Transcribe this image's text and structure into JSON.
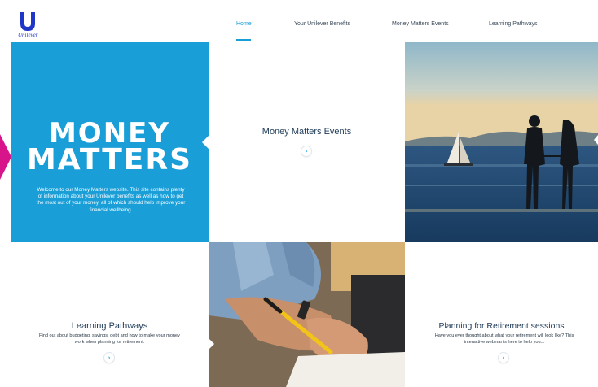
{
  "brand": {
    "logo_text": "Unilever"
  },
  "nav": {
    "items": [
      {
        "label": "Home",
        "active": true
      },
      {
        "label": "Your Unilever Benefits",
        "active": false
      },
      {
        "label": "Money Matters Events",
        "active": false
      },
      {
        "label": "Learning Pathways",
        "active": false
      }
    ]
  },
  "hero": {
    "title_line1": "MONEY",
    "title_line2": "MATTERS",
    "intro": "Welcome to our Money Matters website. This site contains plenty of information about your Unilever benefits as well as how to get the most out of your money, all of which should help improve your financial wellbeing."
  },
  "tiles": {
    "events": {
      "heading": "Money Matters Events"
    },
    "learning": {
      "heading": "Learning Pathways",
      "body": "Find out about budgeting, savings, debt and how to make your money work when planning for retirement."
    },
    "retirement": {
      "heading": "Planning for Retirement sessions",
      "body": "Have you ever thought about what your retirement will look like? This interactive webinar is here to help you..."
    }
  },
  "icons": {
    "arrow": "chevron-right-icon",
    "logo": "unilever-u-logo"
  },
  "colors": {
    "brand_blue": "#1a9ed8",
    "accent_magenta": "#d8148b",
    "text_dark": "#1f3b57",
    "logo_blue": "#1f36c7"
  }
}
